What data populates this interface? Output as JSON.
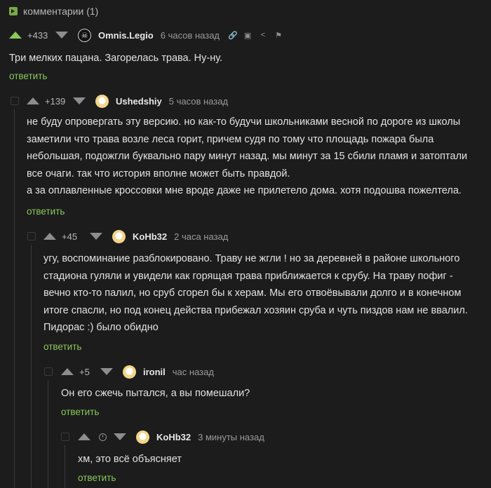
{
  "header": {
    "title": "комментарии (1)",
    "icon": "comments-icon"
  },
  "comments": [
    {
      "score": "+433",
      "author": "Omnis.Legio",
      "avatar_glyph": "☠",
      "time": "6 часов назад",
      "text": "Три мелких пацана. Загорелась трава. Ну-ну.",
      "reply": "ответить"
    },
    {
      "score": "+139",
      "author": "Ushedshiy",
      "time": "5 часов назад",
      "lines": [
        "не буду опровергать эту версию. но как-то будучи школьниками весной по дороге из школы",
        "заметили что трава возле леса горит, причем судя по тому что площадь пожара была",
        "небольшая, подожгли буквально пару минут назад. мы минут за 15 сбили пламя и затоптали",
        "все очаги. так что история вполне может быть правдой.",
        "а за оплавленные кроссовки мне вроде даже не прилетело дома. хотя подошва пожелтела."
      ],
      "reply": "ответить"
    },
    {
      "score": "+45",
      "author": "KoHb32",
      "time": "2 часа назад",
      "lines": [
        "угу, воспоминание разблокировано.  Траву не жгли ! но за деревней в районе школьного",
        "стадиона гуляли и увидели как горящая трава приближается к срубу. На траву пофиг -",
        "вечно кто-то палил, но сруб сгорел бы к херам. Мы его отвоёвывали долго и в конечном",
        "итоге спасли, но под конец действа прибежал хозяин сруба и чуть пиздов нам не ввалил.",
        "Пидорас :) было обидно"
      ],
      "reply": "ответить"
    },
    {
      "score": "+5",
      "author": "ironil",
      "time": "час назад",
      "text": "Он его сжечь пытался, а вы помешали?",
      "reply": "ответить"
    },
    {
      "author": "KoHb32",
      "time": "3 минуты назад",
      "text": "хм, это всё объясняет",
      "reply": "ответить"
    }
  ]
}
